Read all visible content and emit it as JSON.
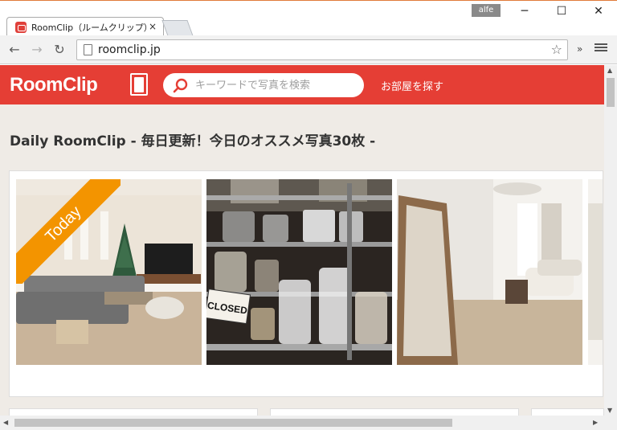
{
  "browser": {
    "tab_title": "RoomClip（ルームクリップ）",
    "tab_close": "×",
    "user_badge": "alfe",
    "win_minimize": "─",
    "win_maximize": "☐",
    "win_close": "✕",
    "url": "roomclip.jp",
    "extensions_chevron": "»"
  },
  "site": {
    "logo_text": "RoomClip",
    "search_placeholder": "キーワードで写真を検索",
    "find_room_label": "お部屋を探す",
    "brand_color": "#e53e35"
  },
  "daily": {
    "title": "Daily RoomClip - 毎日更新！今日のオススメ写真30枚 -",
    "ribbon": "Today",
    "ribbon_color": "#f39400"
  },
  "photos": [
    {
      "subject": "living room with christmas tree"
    },
    {
      "subject": "glass jars on metal shelf with CLOSED sign",
      "sign_text": "CLOSED"
    },
    {
      "subject": "bright living room with floor mirror"
    }
  ]
}
